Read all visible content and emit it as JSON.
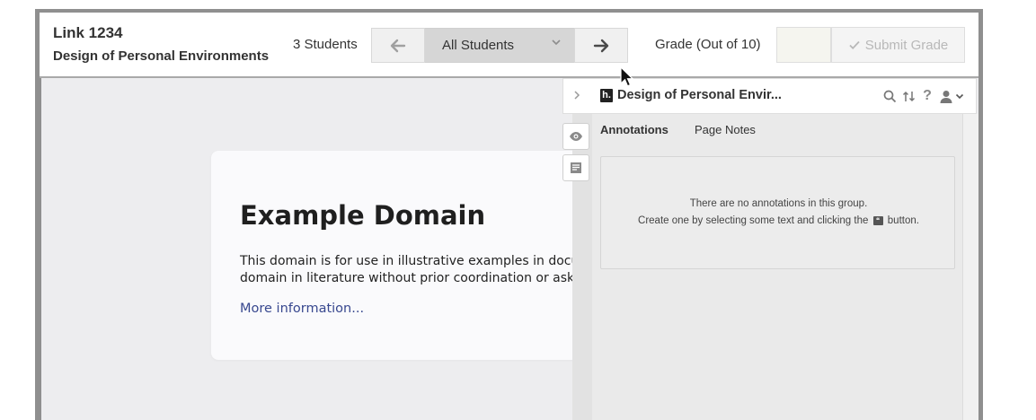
{
  "header": {
    "title": "Link 1234",
    "subtitle": "Design of Personal Environments",
    "student_count": "3 Students",
    "student_select": {
      "selected": "All Students"
    },
    "grade_label": "Grade (Out of 10)",
    "grade_value": "",
    "submit_label": "Submit Grade"
  },
  "content": {
    "heading": "Example Domain",
    "body_line1": "This domain is for use in illustrative examples in documents. You may use this",
    "body_line2": "domain in literature without prior coordination or asking for permission.",
    "link": "More information..."
  },
  "sidebar": {
    "title": "Design of Personal Envir...",
    "logo": "h.",
    "tabs": [
      {
        "label": "Annotations",
        "active": true
      },
      {
        "label": "Page Notes",
        "active": false
      }
    ],
    "empty_line1": "There are no annotations in this group.",
    "empty_line2_pre": "Create one by selecting some text and clicking the",
    "empty_line2_post": "button."
  },
  "icons": [
    "arrow-left-icon",
    "arrow-right-icon",
    "chevron-down-icon",
    "check-icon",
    "chevron-right-icon",
    "search-icon",
    "sort-icon",
    "help-icon",
    "user-icon",
    "eye-icon",
    "page-note-icon",
    "annotate-icon",
    "cursor-icon"
  ],
  "colors": {
    "link": "#38488f",
    "select_bg": "#d6d6d6",
    "disabled_text": "#b8b8b8"
  }
}
